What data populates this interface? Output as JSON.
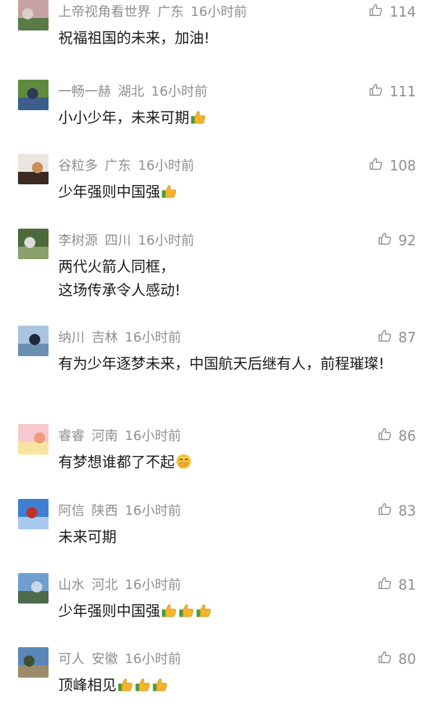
{
  "comments": [
    {
      "user": "上帝视角看世界",
      "location": "广东",
      "time": "16小时前",
      "likes": "114",
      "text": "祝福祖国的未来，加油!",
      "emojis": [],
      "avatar_colors": [
        "#c7a2a5",
        "#5a7a48",
        "#d8d0c8"
      ]
    },
    {
      "user": "一畅一赫",
      "location": "湖北",
      "time": "16小时前",
      "likes": "111",
      "text": "小小少年，未来可期",
      "emojis": [
        "thumbs-up"
      ],
      "avatar_colors": [
        "#5f8a3d",
        "#3a5f8a",
        "#2e3b55"
      ]
    },
    {
      "user": "谷粒多",
      "location": "广东",
      "time": "16小时前",
      "likes": "108",
      "text": "少年强则中国强",
      "emojis": [
        "thumbs-up"
      ],
      "avatar_colors": [
        "#eae6df",
        "#3a2a20",
        "#c8905a"
      ]
    },
    {
      "user": "李树源",
      "location": "四川",
      "time": "16小时前",
      "likes": "92",
      "text": "两代火箭人同框，\n这场传承令人感动!",
      "emojis": [],
      "avatar_colors": [
        "#4c6b3a",
        "#8aa06a",
        "#dcdcdc"
      ]
    },
    {
      "user": "纳川",
      "location": "吉林",
      "time": "16小时前",
      "likes": "87",
      "text": "有为少年逐梦未来，中国航天后继有人，前程璀璨!",
      "emojis": [],
      "avatar_colors": [
        "#a9c4de",
        "#6a8fb0",
        "#1f2a3a"
      ]
    },
    {
      "user": "睿睿",
      "location": "河南",
      "time": "16小时前",
      "likes": "86",
      "text": "有梦想谁都了不起",
      "emojis": [
        "hand-over-mouth"
      ],
      "avatar_colors": [
        "#f6c9cf",
        "#f8e4a0",
        "#f09a7a"
      ]
    },
    {
      "user": "阿信",
      "location": "陕西",
      "time": "16小时前",
      "likes": "83",
      "text": "未来可期",
      "emojis": [],
      "avatar_colors": [
        "#3f7fd0",
        "#a8c9ee",
        "#c0302a"
      ]
    },
    {
      "user": "山水",
      "location": "河北",
      "time": "16小时前",
      "likes": "81",
      "text": "少年强则中国强",
      "emojis": [
        "thumbs-up",
        "thumbs-up",
        "thumbs-up"
      ],
      "avatar_colors": [
        "#6f9fce",
        "#4d6a4a",
        "#c9d8e8"
      ]
    },
    {
      "user": "可人",
      "location": "安徽",
      "time": "16小时前",
      "likes": "80",
      "text": "顶峰相见",
      "emojis": [
        "thumbs-up",
        "thumbs-up",
        "thumbs-up"
      ],
      "avatar_colors": [
        "#5a87b8",
        "#9c8c6a",
        "#3f4e34"
      ]
    }
  ],
  "icons": {
    "like": "thumbs-up-outline-icon"
  },
  "colors": {
    "meta": "#8f8f8f",
    "text": "#1a1a1a",
    "emoji_hand": "#f5b42a",
    "emoji_cuff": "#4a9a3a"
  }
}
